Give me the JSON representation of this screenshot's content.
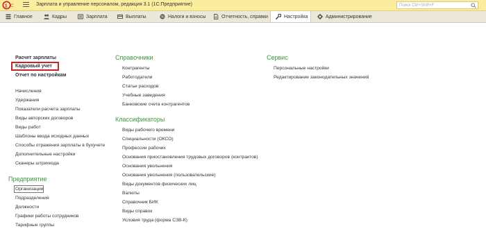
{
  "window": {
    "title": "Зарплата и управление персоналом, редакция 3.1  (1С:Предприятие)",
    "search_placeholder": "Поиск Ctrl+Shift+F"
  },
  "sections": [
    {
      "label": "Главное",
      "icon": "home-icon"
    },
    {
      "label": "Кадры",
      "icon": "people-icon"
    },
    {
      "label": "Зарплата",
      "icon": "salary-icon"
    },
    {
      "label": "Выплаты",
      "icon": "payments-icon"
    },
    {
      "label": "Налоги и взносы",
      "icon": "percent-icon"
    },
    {
      "label": "Отчетность, справки",
      "icon": "reports-icon"
    },
    {
      "label": "Настройка",
      "icon": "wrench-icon",
      "active": true
    },
    {
      "label": "Администрирование",
      "icon": "gear-icon"
    }
  ],
  "left": {
    "top_links": [
      "Расчет зарплаты",
      "Кадровый учет",
      "Отчет по настройкам"
    ],
    "links": [
      "Начисления",
      "Удержания",
      "Показатели расчета зарплаты",
      "Виды авторских договоров",
      "Виды работ",
      "Шаблоны ввода исходных данных",
      "Способы отражения зарплаты в бухучете",
      "Дополнительные настройки",
      "Сканеры штрихкода"
    ],
    "enterprise_heading": "Предприятие",
    "enterprise_links": [
      "Организации",
      "Подразделения",
      "Должности",
      "Графики работы сотрудников",
      "Тарифные группы"
    ]
  },
  "middle": {
    "directories_heading": "Справочники",
    "directories": [
      "Контрагенты",
      "Работодатели",
      "Статьи расходов",
      "Учебные заведения",
      "Банковские счета контрагентов"
    ],
    "classifiers_heading": "Классификаторы",
    "classifiers": [
      "Виды рабочего времени",
      "Специальности (ОКСО)",
      "Профессии рабочих",
      "Основания приостановления трудовых договоров (контрактов)",
      "Основания увольнения",
      "Основания увольнения (пользовательские)",
      "Виды документов физических лиц",
      "Валюты",
      "Справочник БИК",
      "Виды справок",
      "Условия труда (форма СЗВ-К)"
    ]
  },
  "right": {
    "service_heading": "Сервис",
    "service": [
      "Персональные настройки",
      "Редактирование законодательных значений"
    ]
  }
}
